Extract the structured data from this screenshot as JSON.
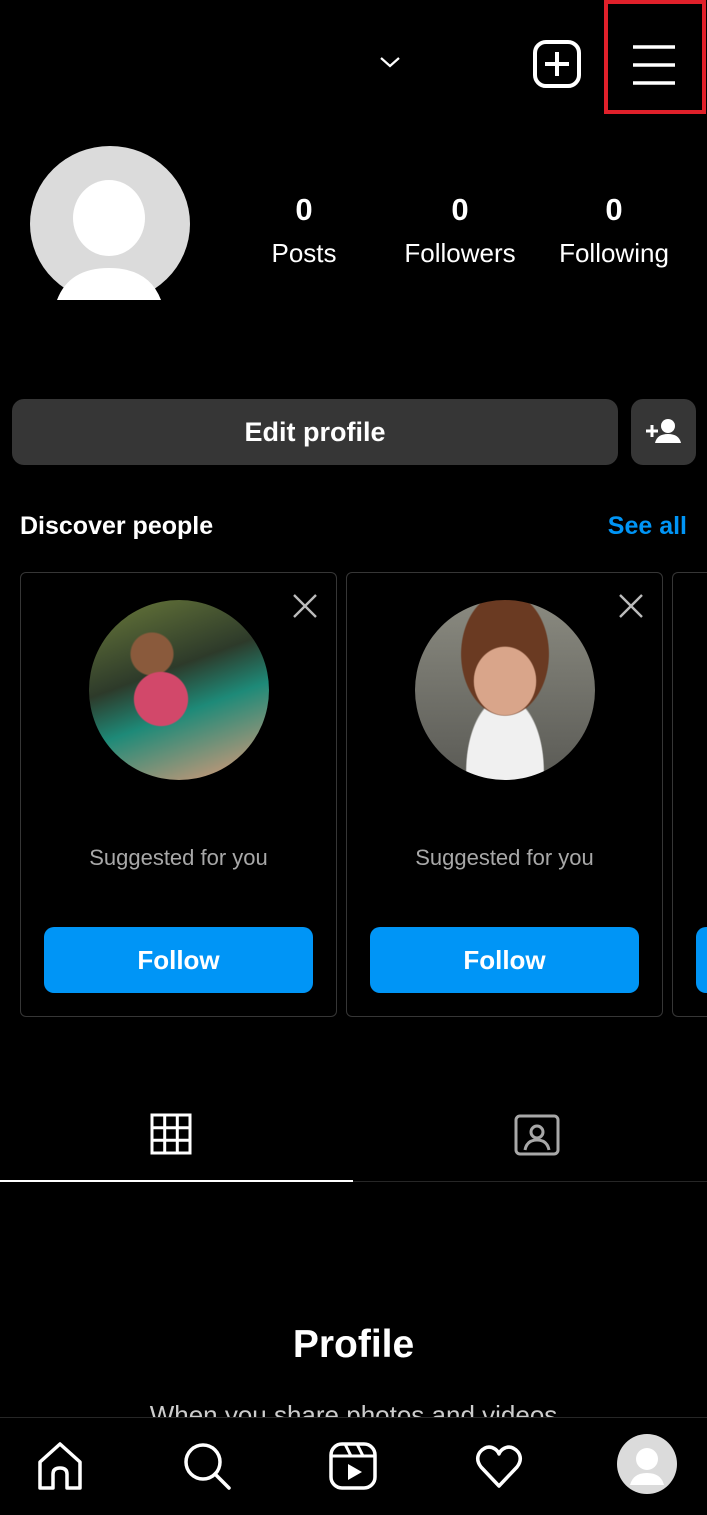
{
  "header": {
    "username": "",
    "icons": [
      "chevron-down-icon",
      "new-post-icon",
      "menu-icon"
    ],
    "highlight_color": "#e0202a"
  },
  "profile": {
    "stats": [
      {
        "value": "0",
        "label": "Posts"
      },
      {
        "value": "0",
        "label": "Followers"
      },
      {
        "value": "0",
        "label": "Following"
      }
    ],
    "edit_label": "Edit profile"
  },
  "discover": {
    "title": "Discover people",
    "see_all": "See all",
    "cards": [
      {
        "subtitle": "Suggested for you",
        "button": "Follow"
      },
      {
        "subtitle": "Suggested for you",
        "button": "Follow"
      }
    ]
  },
  "tabs": [
    "grid-icon",
    "tagged-icon"
  ],
  "empty": {
    "title": "Profile",
    "subtitle": "When you share photos and videos"
  },
  "bottom_nav": [
    "home-icon",
    "search-icon",
    "reels-icon",
    "heart-icon",
    "profile-avatar"
  ],
  "colors": {
    "accent": "#0095f6",
    "button_bg": "#363636"
  }
}
